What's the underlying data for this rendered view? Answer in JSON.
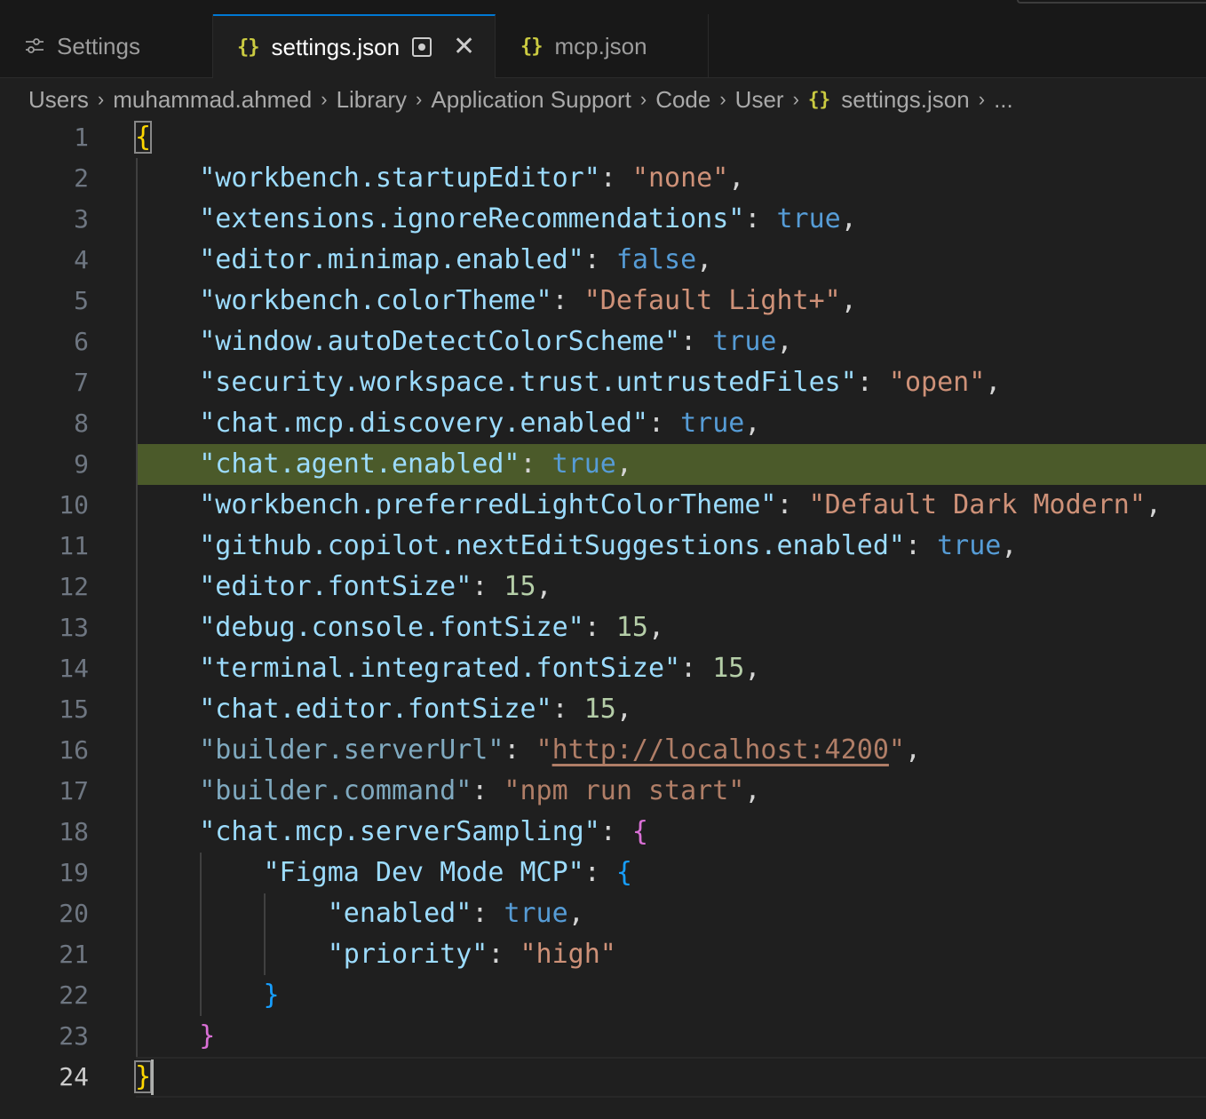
{
  "tabs": [
    {
      "label": "Settings",
      "icon": "settings-sliders-icon"
    },
    {
      "label": "settings.json",
      "icon": "json-braces-icon",
      "active": true,
      "dirty": true
    },
    {
      "label": "mcp.json",
      "icon": "json-braces-icon"
    }
  ],
  "tab_icons": {
    "braces": "{}",
    "close": "✕"
  },
  "breadcrumb": {
    "items": [
      "Users",
      "muhammad.ahmed",
      "Library",
      "Application Support",
      "Code",
      "User",
      "settings.json",
      "..."
    ],
    "separator": "›"
  },
  "editor": {
    "line_numbers": [
      "1",
      "2",
      "3",
      "4",
      "5",
      "6",
      "7",
      "8",
      "9",
      "10",
      "11",
      "12",
      "13",
      "14",
      "15",
      "16",
      "17",
      "18",
      "19",
      "20",
      "21",
      "22",
      "23",
      "24"
    ],
    "highlighted_line": 9,
    "current_line": 24,
    "colors": {
      "background": "#1f1f1f",
      "highlight": "#4b5a2a",
      "key": "#9cdcfe",
      "string": "#ce9178",
      "boolean": "#569cd6",
      "number": "#b5cea8"
    },
    "lines": [
      {
        "indent": "",
        "key": "",
        "value": "",
        "open": "{"
      },
      {
        "indent": "    ",
        "key": "\"workbench.startupEditor\"",
        "value": "\"none\"",
        "vtype": "s",
        "comma": ","
      },
      {
        "indent": "    ",
        "key": "\"extensions.ignoreRecommendations\"",
        "value": "true",
        "vtype": "b",
        "comma": ","
      },
      {
        "indent": "    ",
        "key": "\"editor.minimap.enabled\"",
        "value": "false",
        "vtype": "b",
        "comma": ","
      },
      {
        "indent": "    ",
        "key": "\"workbench.colorTheme\"",
        "value": "\"Default Light+\"",
        "vtype": "s",
        "comma": ","
      },
      {
        "indent": "    ",
        "key": "\"window.autoDetectColorScheme\"",
        "value": "true",
        "vtype": "b",
        "comma": ","
      },
      {
        "indent": "    ",
        "key": "\"security.workspace.trust.untrustedFiles\"",
        "value": "\"open\"",
        "vtype": "s",
        "comma": ","
      },
      {
        "indent": "    ",
        "key": "\"chat.mcp.discovery.enabled\"",
        "value": "true",
        "vtype": "b",
        "comma": ","
      },
      {
        "indent": "    ",
        "key": "\"chat.agent.enabled\"",
        "value": "true",
        "vtype": "b",
        "comma": ","
      },
      {
        "indent": "    ",
        "key": "\"workbench.preferredLightColorTheme\"",
        "value": "\"Default Dark Modern\"",
        "vtype": "s",
        "comma": ","
      },
      {
        "indent": "    ",
        "key": "\"github.copilot.nextEditSuggestions.enabled\"",
        "value": "true",
        "vtype": "b",
        "comma": ","
      },
      {
        "indent": "    ",
        "key": "\"editor.fontSize\"",
        "value": "15",
        "vtype": "n",
        "comma": ","
      },
      {
        "indent": "    ",
        "key": "\"debug.console.fontSize\"",
        "value": "15",
        "vtype": "n",
        "comma": ","
      },
      {
        "indent": "    ",
        "key": "\"terminal.integrated.fontSize\"",
        "value": "15",
        "vtype": "n",
        "comma": ","
      },
      {
        "indent": "    ",
        "key": "\"chat.editor.fontSize\"",
        "value": "15",
        "vtype": "n",
        "comma": ","
      },
      {
        "indent": "    ",
        "key": "\"builder.serverUrl\"",
        "value_q1": "\"",
        "value_link": "http://localhost:4200",
        "value_q2": "\"",
        "vtype": "link",
        "comma": ",",
        "dim": true
      },
      {
        "indent": "    ",
        "key": "\"builder.command\"",
        "value": "\"npm run start\"",
        "vtype": "s",
        "comma": ",",
        "dim": true
      },
      {
        "indent": "    ",
        "key": "\"chat.mcp.serverSampling\"",
        "open": "{",
        "otype": "m"
      },
      {
        "indent": "        ",
        "key": "\"Figma Dev Mode MCP\"",
        "open": "{",
        "otype": "bl"
      },
      {
        "indent": "            ",
        "key": "\"enabled\"",
        "value": "true",
        "vtype": "b",
        "comma": ","
      },
      {
        "indent": "            ",
        "key": "\"priority\"",
        "value": "\"high\"",
        "vtype": "s"
      },
      {
        "indent": "        ",
        "close": "}",
        "ctype": "bl"
      },
      {
        "indent": "    ",
        "close": "}",
        "ctype": "m"
      },
      {
        "indent": "",
        "close": "}",
        "ctype": "y",
        "match": true
      }
    ]
  }
}
